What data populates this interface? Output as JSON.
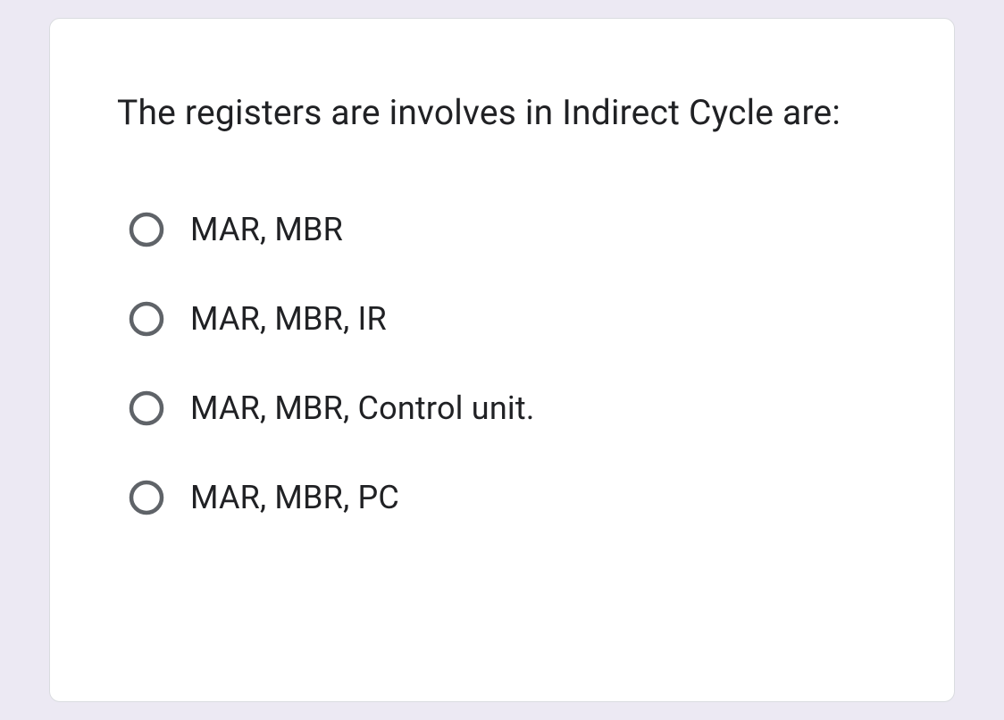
{
  "question": {
    "text": "The registers are involves in Indirect Cycle  are:"
  },
  "options": [
    {
      "label": "MAR, MBR"
    },
    {
      "label": "MAR, MBR, IR"
    },
    {
      "label": "MAR, MBR, Control unit."
    },
    {
      "label": "MAR, MBR, PC"
    }
  ],
  "colors": {
    "radio_stroke": "#5f6368",
    "text": "#202124",
    "bg": "#ece9f3",
    "card_bg": "#ffffff",
    "card_border": "#dadce0"
  }
}
